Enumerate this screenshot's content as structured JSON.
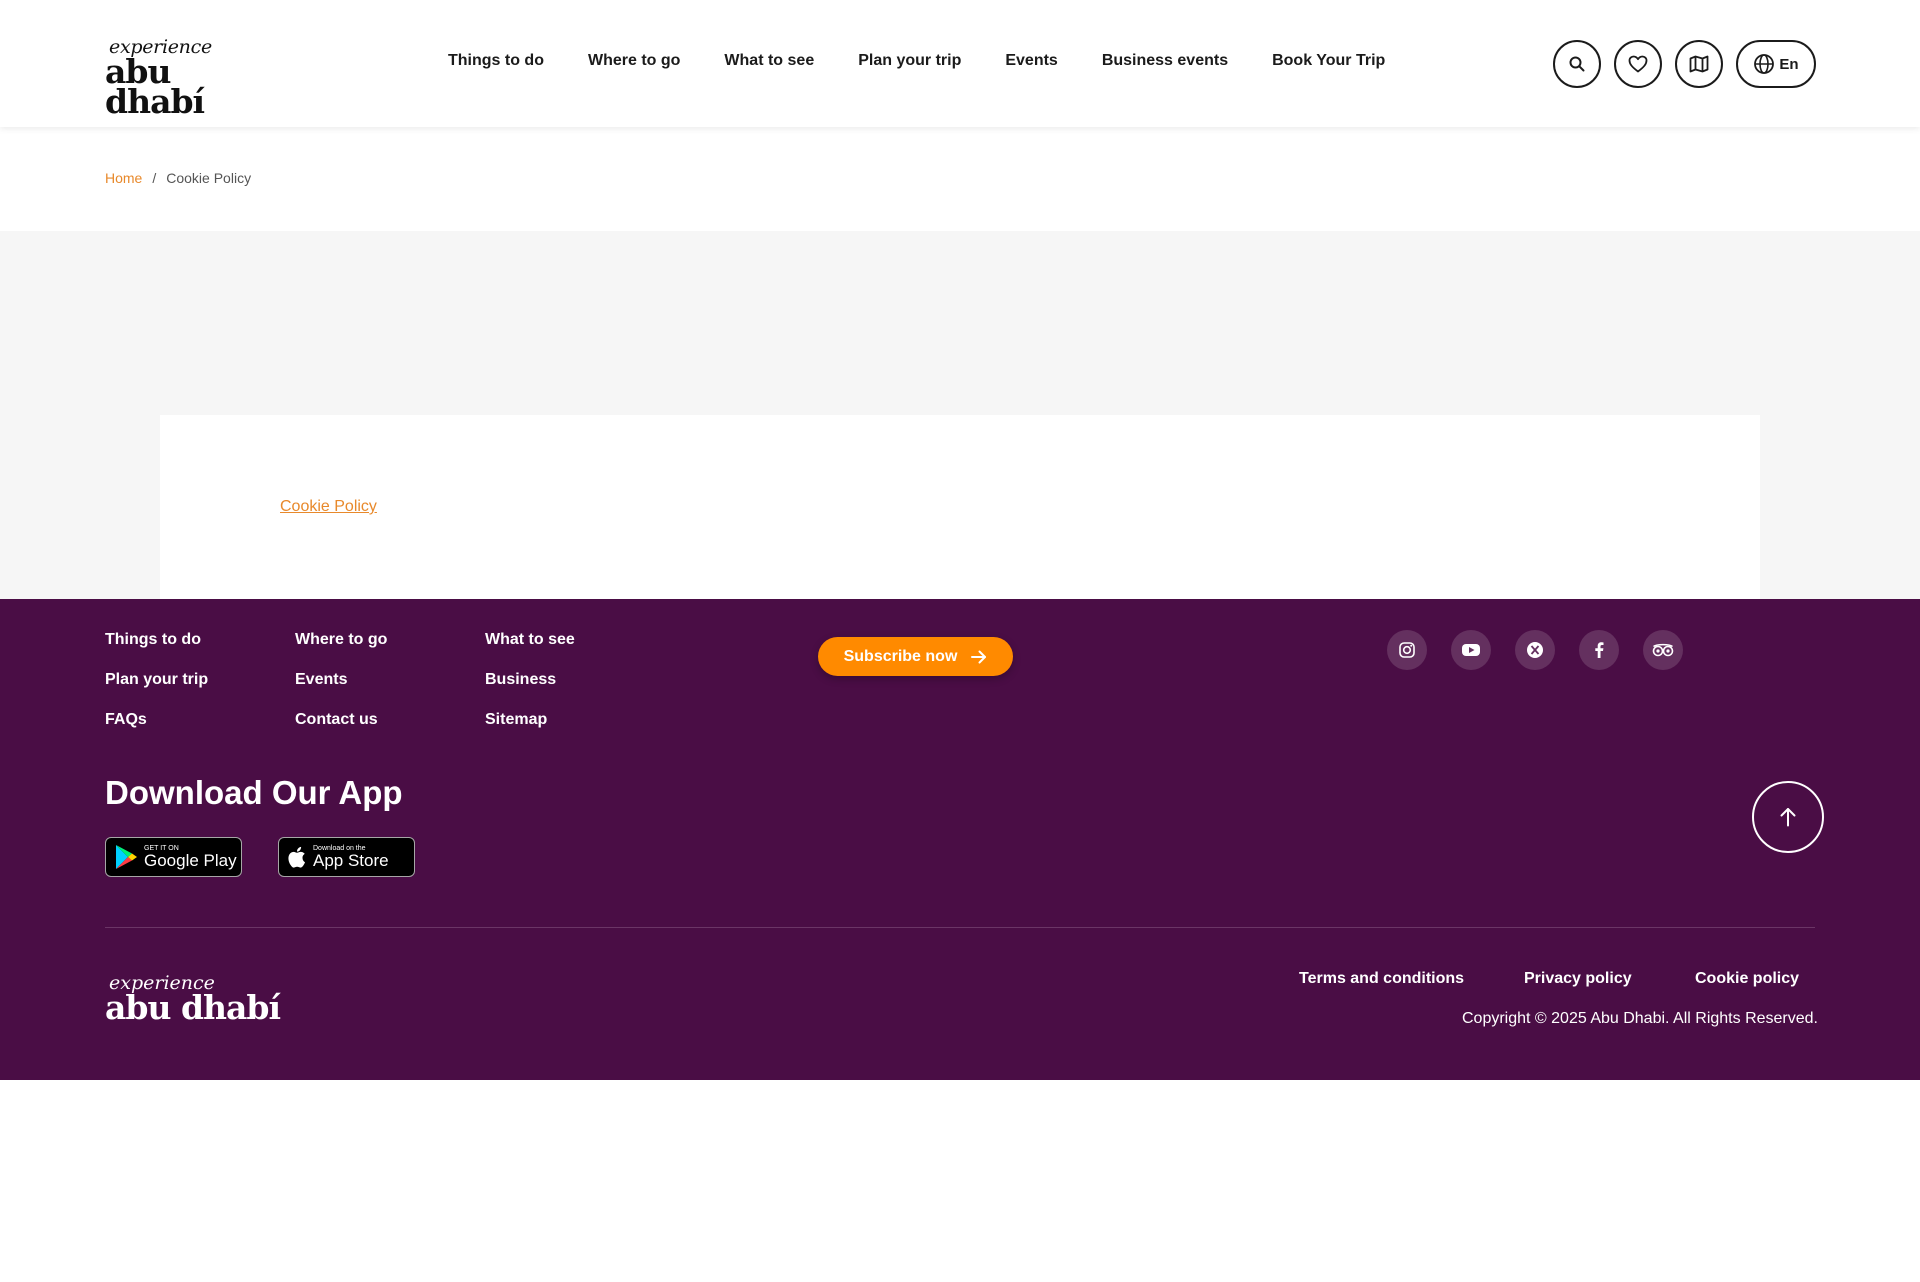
{
  "header": {
    "logo_small": "experience",
    "logo_big": "abu dhabí",
    "nav": [
      "Things to do",
      "Where to go",
      "What to see",
      "Plan your trip",
      "Events",
      "Business events",
      "Book Your Trip"
    ],
    "lang": "En"
  },
  "breadcrumb": {
    "home": "Home",
    "separator": "/",
    "current": "Cookie Policy"
  },
  "card": {
    "link": "Cookie Policy"
  },
  "footer": {
    "links": [
      "Things to do",
      "Where to go",
      "What to see",
      "Plan your trip",
      "Events",
      "Business",
      "FAQs",
      "Contact us",
      "Sitemap"
    ],
    "subscribe": "Subscribe now",
    "app_title": "Download Our App",
    "google_play": {
      "line1": "GET IT ON",
      "line2": "Google Play"
    },
    "app_store": {
      "line1": "Download on the",
      "line2": "App Store"
    },
    "logo_small": "experience",
    "logo_big": "abu dhabí",
    "legal": [
      "Terms and conditions",
      "Privacy policy",
      "Cookie policy"
    ],
    "copyright": "Copyright © 2025 Abu Dhabi. All Rights Reserved."
  },
  "colors": {
    "accent": "#ff8a00",
    "link": "#e8892b",
    "footer_bg": "#4a0d45"
  }
}
